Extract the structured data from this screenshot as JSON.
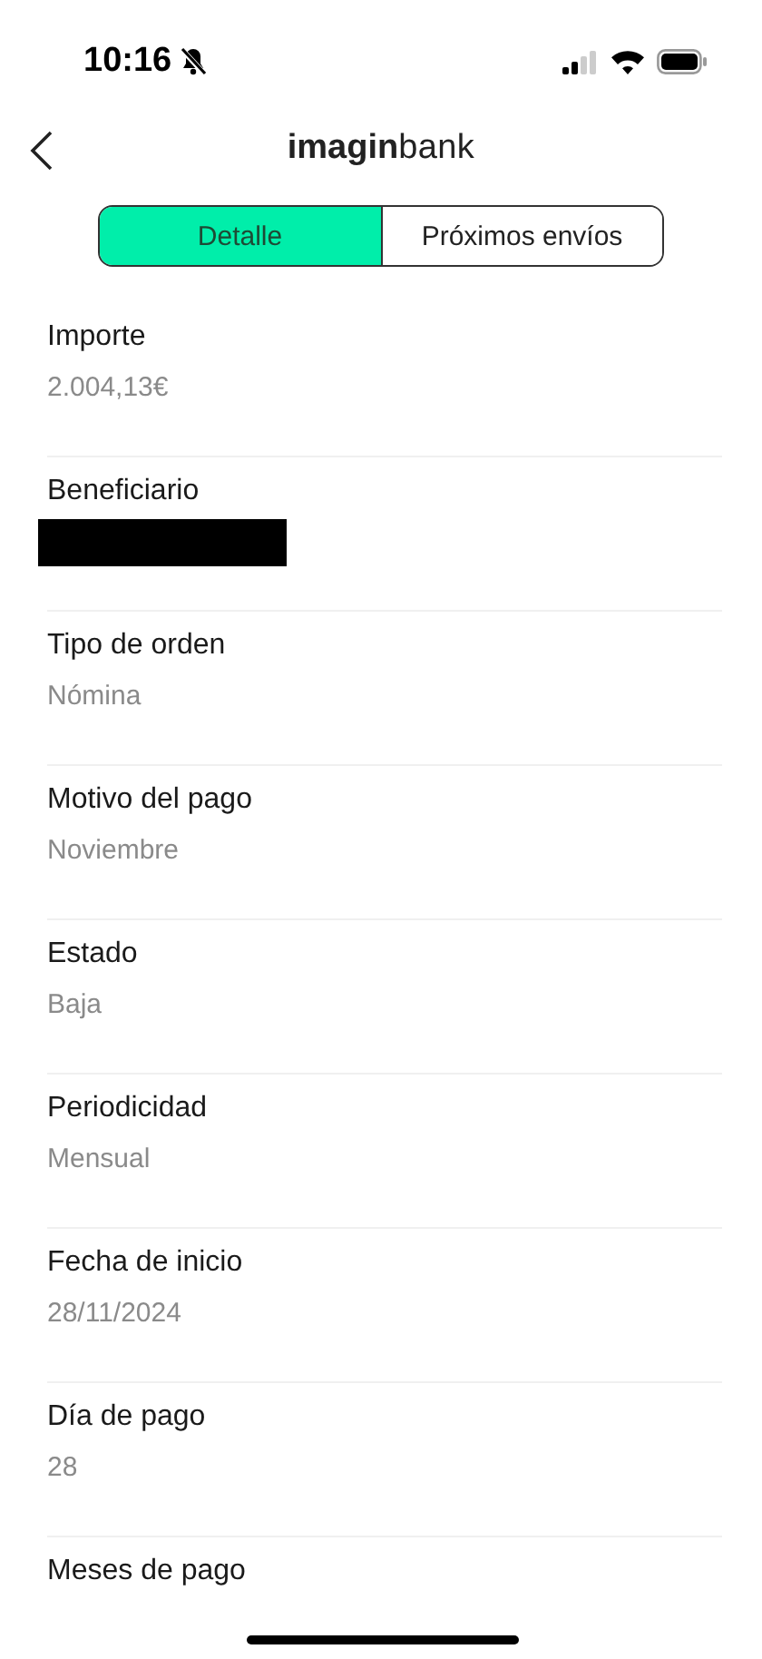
{
  "status_bar": {
    "time": "10:16",
    "silent": true
  },
  "header": {
    "logo": "**imagin**bank"
  },
  "tabs": [
    {
      "label": "Detalle",
      "selected": true
    },
    {
      "label": "Próximos envíos",
      "selected": false
    }
  ],
  "fields": [
    {
      "label": "Importe",
      "value": "2.004,13€"
    },
    {
      "label": "Beneficiario",
      "redacted": true
    },
    {
      "label": "Tipo de orden",
      "value": "Nómina"
    },
    {
      "label": "Motivo del pago",
      "value": "Noviembre"
    },
    {
      "label": "Estado",
      "value": "Baja"
    },
    {
      "label": "Periodicidad",
      "value": "Mensual"
    },
    {
      "label": "Fecha de inicio",
      "value": "28/11/2024"
    },
    {
      "label": "Día de pago",
      "value": "28"
    },
    {
      "label": "Meses de pago"
    }
  ]
}
